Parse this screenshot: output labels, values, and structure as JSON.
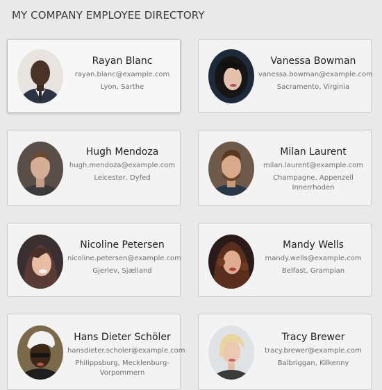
{
  "header": {
    "title": "MY COMPANY EMPLOYEE DIRECTORY"
  },
  "employees": [
    {
      "name": "Rayan Blanc",
      "email": "rayan.blanc@example.com",
      "location": "Lyon, Sarthe",
      "avatar": "man-suit-photo"
    },
    {
      "name": "Vanessa Bowman",
      "email": "vanessa.bowman@example.com",
      "location": "Sacramento, Virginia",
      "avatar": "woman-dark-hair-photo"
    },
    {
      "name": "Hugh Mendoza",
      "email": "hugh.mendoza@example.com",
      "location": "Leicester, Dyfed",
      "avatar": "man-photo"
    },
    {
      "name": "Milan Laurent",
      "email": "milan.laurent@example.com",
      "location": "Champagne, Appenzell Innerrhoden",
      "avatar": "man-beard-photo"
    },
    {
      "name": "Nicoline Petersen",
      "email": "nicoline.petersen@example.com",
      "location": "Gjerlev, Sjælland",
      "avatar": "woman-photo"
    },
    {
      "name": "Mandy Wells",
      "email": "mandy.wells@example.com",
      "location": "Belfast, Grampian",
      "avatar": "woman-curly-hair-photo"
    },
    {
      "name": "Hans Dieter Schöler",
      "email": "hansdieter.scholer@example.com",
      "location": "Philippsburg, Mecklenburg-Vorpommern",
      "avatar": "man-cap-photo"
    },
    {
      "name": "Tracy Brewer",
      "email": "tracy.brewer@example.com",
      "location": "Balbriggan, Kilkenny",
      "avatar": "woman-blonde-photo"
    }
  ]
}
